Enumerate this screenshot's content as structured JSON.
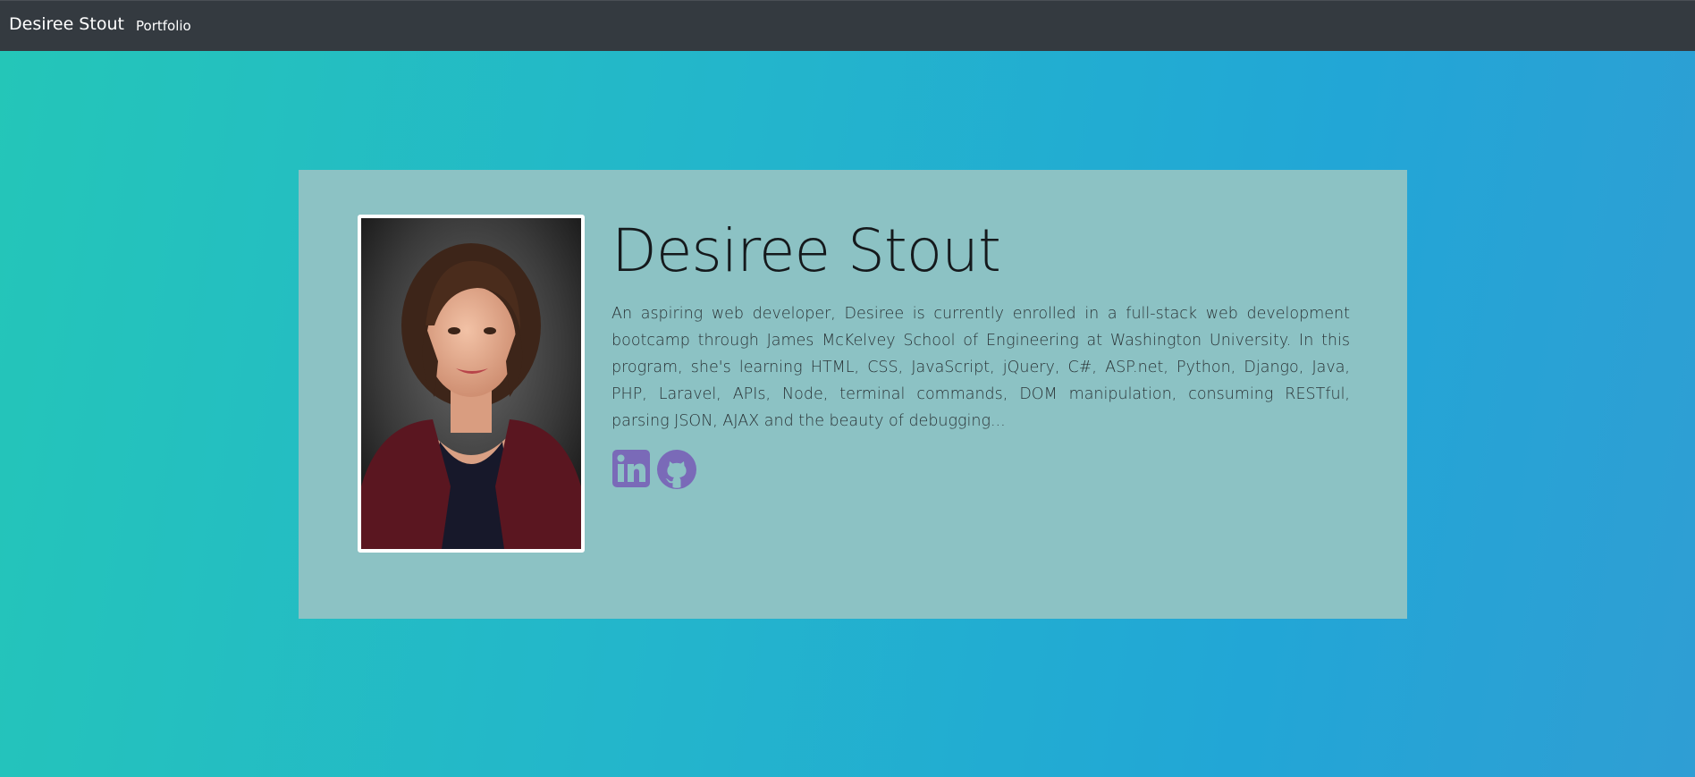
{
  "navbar": {
    "brand": "Desiree Stout",
    "links": [
      {
        "label": "Portfolio"
      }
    ]
  },
  "profile": {
    "name": "Desiree Stout",
    "bio": "An aspiring web developer, Desiree is currently enrolled in a full-stack web development bootcamp through James McKelvey School of Engineering at Washington University. In this program, she's learning HTML, CSS, JavaScript, jQuery, C#, ASP.net, Python, Django, Java, PHP, Laravel, APIs, Node, terminal commands, DOM manipulation, consuming RESTful, parsing JSON, AJAX and the beauty of debugging...",
    "photo_alt": "Desiree Stout",
    "social": [
      {
        "icon": "linkedin-icon",
        "label": "LinkedIn"
      },
      {
        "icon": "github-icon",
        "label": "GitHub"
      }
    ]
  },
  "colors": {
    "navbar_bg": "#343a40",
    "card_bg": "#8cc2c4",
    "icon_color": "#7a6ab8",
    "gradient_start": "#24c6b8",
    "gradient_end": "#22a6d6"
  }
}
